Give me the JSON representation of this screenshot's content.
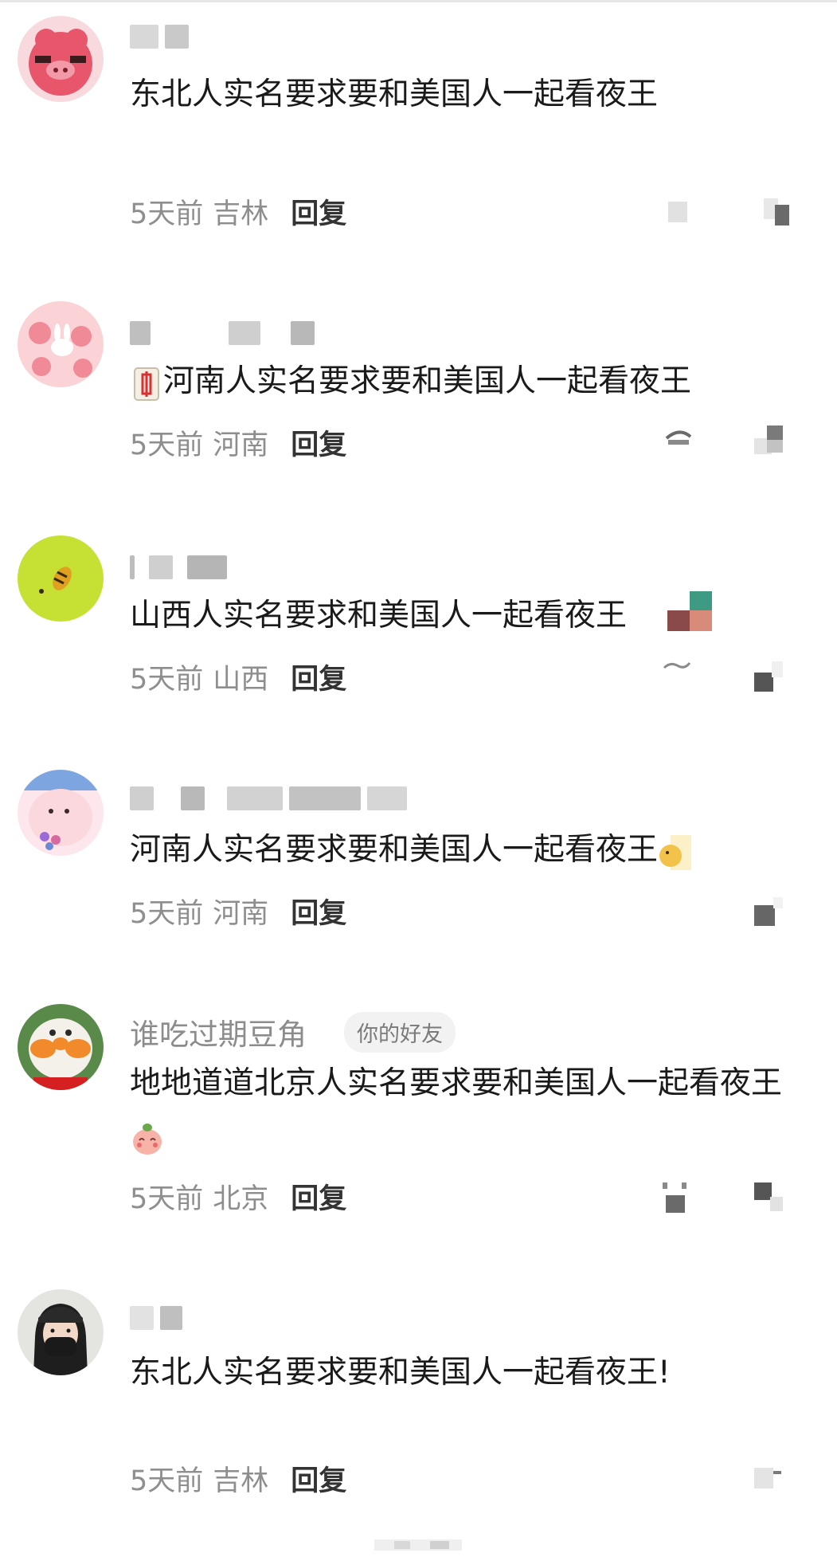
{
  "comments": [
    {
      "name": "",
      "text": "东北人实名要求要和美国人一起看夜王",
      "time": "5天前",
      "location": "吉林",
      "reply": "回复",
      "avatar_icon": "pink-cartoon-pig-avatar"
    },
    {
      "name": "",
      "text": "河南人实名要求要和美国人一起看夜王",
      "time": "5天前",
      "location": "河南",
      "reply": "回复",
      "avatar_icon": "pink-cherry-bunny-avatar",
      "prefix_emoji": "mahjong-red-dragon-emoji"
    },
    {
      "name": "",
      "text": "山西人实名要求和美国人一起看夜王",
      "time": "5天前",
      "location": "山西",
      "reply": "回复",
      "avatar_icon": "green-circle-bee-avatar"
    },
    {
      "name": "",
      "text": "河南人实名要求要和美国人一起看夜王",
      "time": "5天前",
      "location": "河南",
      "reply": "回复",
      "avatar_icon": "pink-blob-flowers-avatar",
      "suffix_emoji": "yellow-face-emoji"
    },
    {
      "name": "谁吃过期豆角",
      "badge": "你的好友",
      "text": "地地道道北京人实名要求要和美国人一起看夜王",
      "time": "5天前",
      "location": "北京",
      "reply": "回复",
      "avatar_icon": "orange-cheek-mascot-avatar",
      "suffix_emoji": "peach-blush-emoji"
    },
    {
      "name": "",
      "text": "东北人实名要求要和美国人一起看夜王!",
      "time": "5天前",
      "location": "吉林",
      "reply": "回复",
      "avatar_icon": "masked-woman-photo-avatar"
    }
  ],
  "colors": {
    "name_gray": "#8c8c8c",
    "meta_gray": "#8e8e8e",
    "reply_dark": "#333333",
    "text_dark": "#1a1a1a",
    "badge_bg": "#f2f2f2"
  }
}
